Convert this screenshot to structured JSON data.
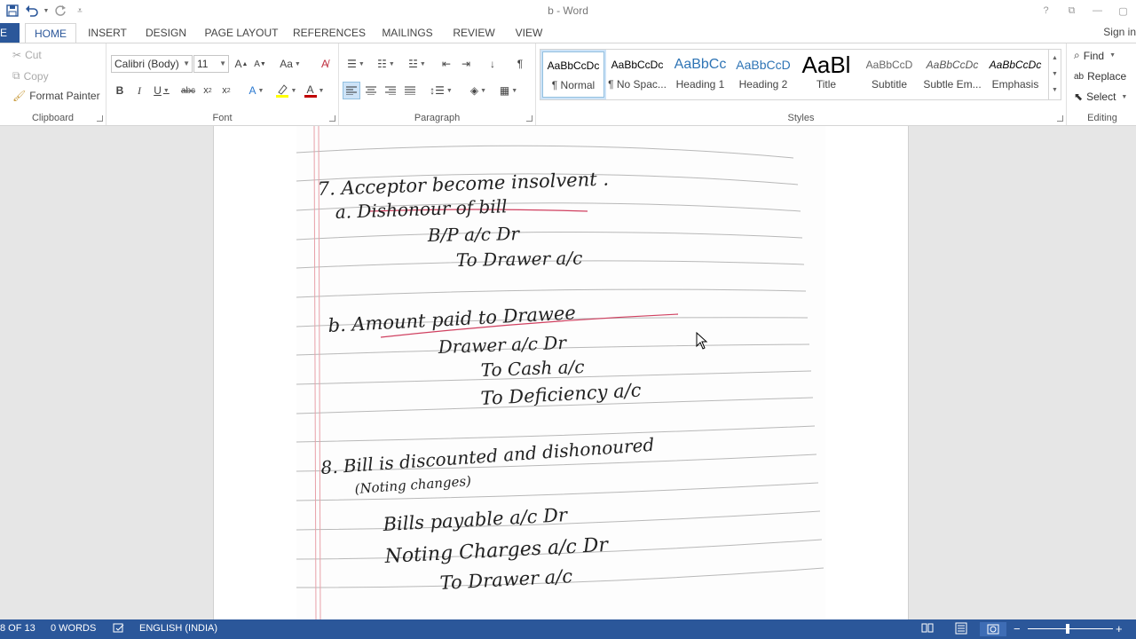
{
  "window": {
    "title": "b - Word",
    "help": "?",
    "restore": "⧉",
    "minimize": "—",
    "maximize": "▢"
  },
  "tabs": [
    "E",
    "HOME",
    "INSERT",
    "DESIGN",
    "PAGE LAYOUT",
    "REFERENCES",
    "MAILINGS",
    "REVIEW",
    "VIEW"
  ],
  "signin": "Sign in",
  "clipboard": {
    "cut": "Cut",
    "copy": "Copy",
    "format_painter": "Format Painter",
    "label": "Clipboard"
  },
  "font": {
    "name": "Calibri (Body)",
    "size": "11",
    "label": "Font"
  },
  "paragraph": {
    "label": "Paragraph"
  },
  "styles": {
    "label": "Styles",
    "items": [
      {
        "preview": "AaBbCcDc",
        "name": "¶ Normal"
      },
      {
        "preview": "AaBbCcDc",
        "name": "¶ No Spac..."
      },
      {
        "preview": "AaBbCc",
        "name": "Heading 1"
      },
      {
        "preview": "AaBbCcD",
        "name": "Heading 2"
      },
      {
        "preview": "AaBl",
        "name": "Title"
      },
      {
        "preview": "AaBbCcD",
        "name": "Subtitle"
      },
      {
        "preview": "AaBbCcDc",
        "name": "Subtle Em..."
      },
      {
        "preview": "AaBbCcDc",
        "name": "Emphasis"
      }
    ]
  },
  "editing": {
    "find": "Find",
    "replace": "Replace",
    "select": "Select",
    "label": "Editing"
  },
  "notes": {
    "line_1": "7. Acceptor become insolvent .",
    "line_2": "a. Dishonour of bill",
    "line_3": "B/P a/c Dr",
    "line_4": "To Drawer a/c",
    "line_5": "b. Amount paid to Drawee",
    "line_6": "Drawer a/c Dr",
    "line_7": "To Cash a/c",
    "line_8": "To Deficiency a/c",
    "line_9": "8. Bill is discounted and dishonoured",
    "line_10": "(Noting changes)",
    "line_11": "Bills payable a/c Dr",
    "line_12": "Noting Charges a/c Dr",
    "line_13": "To Drawer a/c"
  },
  "status": {
    "page": "8 OF 13",
    "words": "0 WORDS",
    "language": "ENGLISH (INDIA)"
  },
  "colors": {
    "accent": "#2b579a",
    "font_color": "#c00000",
    "highlight": "#ffff00",
    "rule_line": "#b8b8b8",
    "margin_line": "#e8a0a8"
  }
}
